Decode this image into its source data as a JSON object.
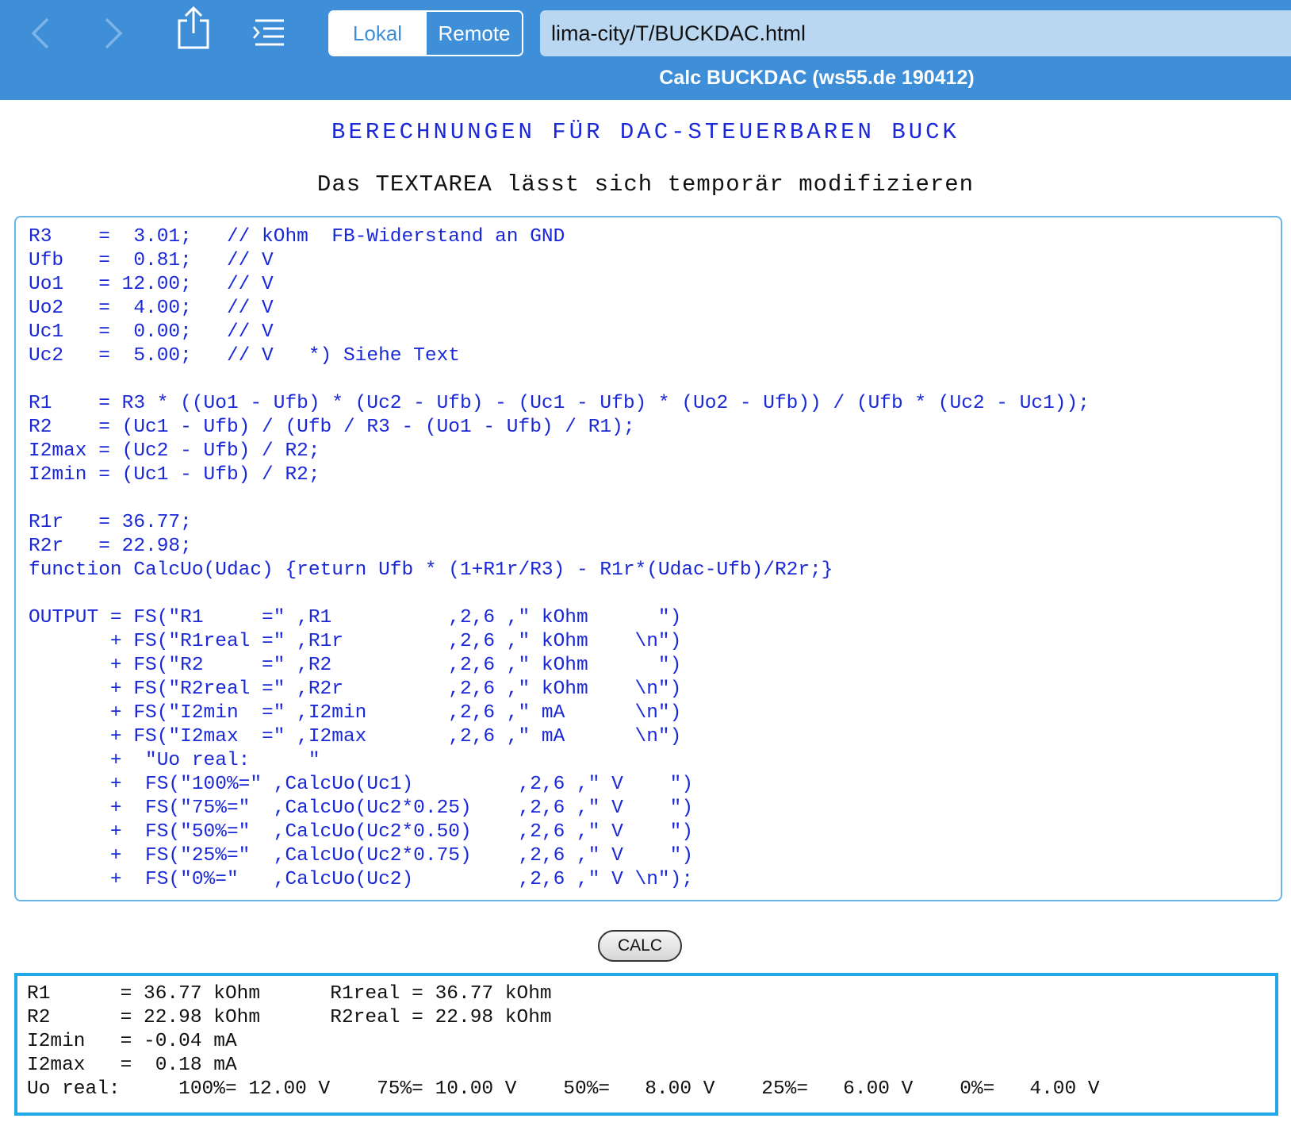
{
  "toolbar": {
    "icons": {
      "back": "chevron-left-icon",
      "forward": "chevron-right-icon",
      "share": "share-icon",
      "menu": "list-menu-icon"
    },
    "segment": {
      "local": "Lokal",
      "remote": "Remote",
      "selected": "Remote"
    },
    "url": "lima-city/T/BUCKDAC.html",
    "window_title": "Calc BUCKDAC (ws55.de 190412)",
    "colors": {
      "bar": "#3f8fd8",
      "url_field": "#b9d7f1"
    }
  },
  "page": {
    "heading": "BERECHNUNGEN FÜR DAC-STEUERBAREN BUCK",
    "subheading": "Das TEXTAREA lässt sich temporär modifizieren"
  },
  "editor": {
    "code": "R3    =  3.01;   // kOhm  FB-Widerstand an GND\nUfb   =  0.81;   // V\nUo1   = 12.00;   // V\nUo2   =  4.00;   // V\nUc1   =  0.00;   // V\nUc2   =  5.00;   // V   *) Siehe Text\n\nR1    = R3 * ((Uo1 - Ufb) * (Uc2 - Ufb) - (Uc1 - Ufb) * (Uo2 - Ufb)) / (Ufb * (Uc2 - Uc1));\nR2    = (Uc1 - Ufb) / (Ufb / R3 - (Uo1 - Ufb) / R1);\nI2max = (Uc2 - Ufb) / R2;\nI2min = (Uc1 - Ufb) / R2;\n\nR1r   = 36.77;\nR2r   = 22.98;\nfunction CalcUo(Udac) {return Ufb * (1+R1r/R3) - R1r*(Udac-Ufb)/R2r;}\n\nOUTPUT = FS(\"R1     =\" ,R1          ,2,6 ,\" kOhm      \")\n       + FS(\"R1real =\" ,R1r         ,2,6 ,\" kOhm    \\n\")\n       + FS(\"R2     =\" ,R2          ,2,6 ,\" kOhm      \")\n       + FS(\"R2real =\" ,R2r         ,2,6 ,\" kOhm    \\n\")\n       + FS(\"I2min  =\" ,I2min       ,2,6 ,\" mA      \\n\")\n       + FS(\"I2max  =\" ,I2max       ,2,6 ,\" mA      \\n\")\n       +  \"Uo real:     \"\n       +  FS(\"100%=\" ,CalcUo(Uc1)         ,2,6 ,\" V    \")\n       +  FS(\"75%=\"  ,CalcUo(Uc2*0.25)    ,2,6 ,\" V    \")\n       +  FS(\"50%=\"  ,CalcUo(Uc2*0.50)    ,2,6 ,\" V    \")\n       +  FS(\"25%=\"  ,CalcUo(Uc2*0.75)    ,2,6 ,\" V    \")\n       +  FS(\"0%=\"   ,CalcUo(Uc2)         ,2,6 ,\" V \\n\");",
    "text_color": "#1a28d6",
    "border_color": "#6ab7ea"
  },
  "calc_button": "CALC",
  "output": {
    "text": "R1      = 36.77 kOhm      R1real = 36.77 kOhm\nR2      = 22.98 kOhm      R2real = 22.98 kOhm\nI2min   = -0.04 mA\nI2max   =  0.18 mA\nUo real:     100%= 12.00 V    75%= 10.00 V    50%=   8.00 V    25%=   6.00 V    0%=   4.00 V",
    "border_color": "#22a8e6"
  }
}
